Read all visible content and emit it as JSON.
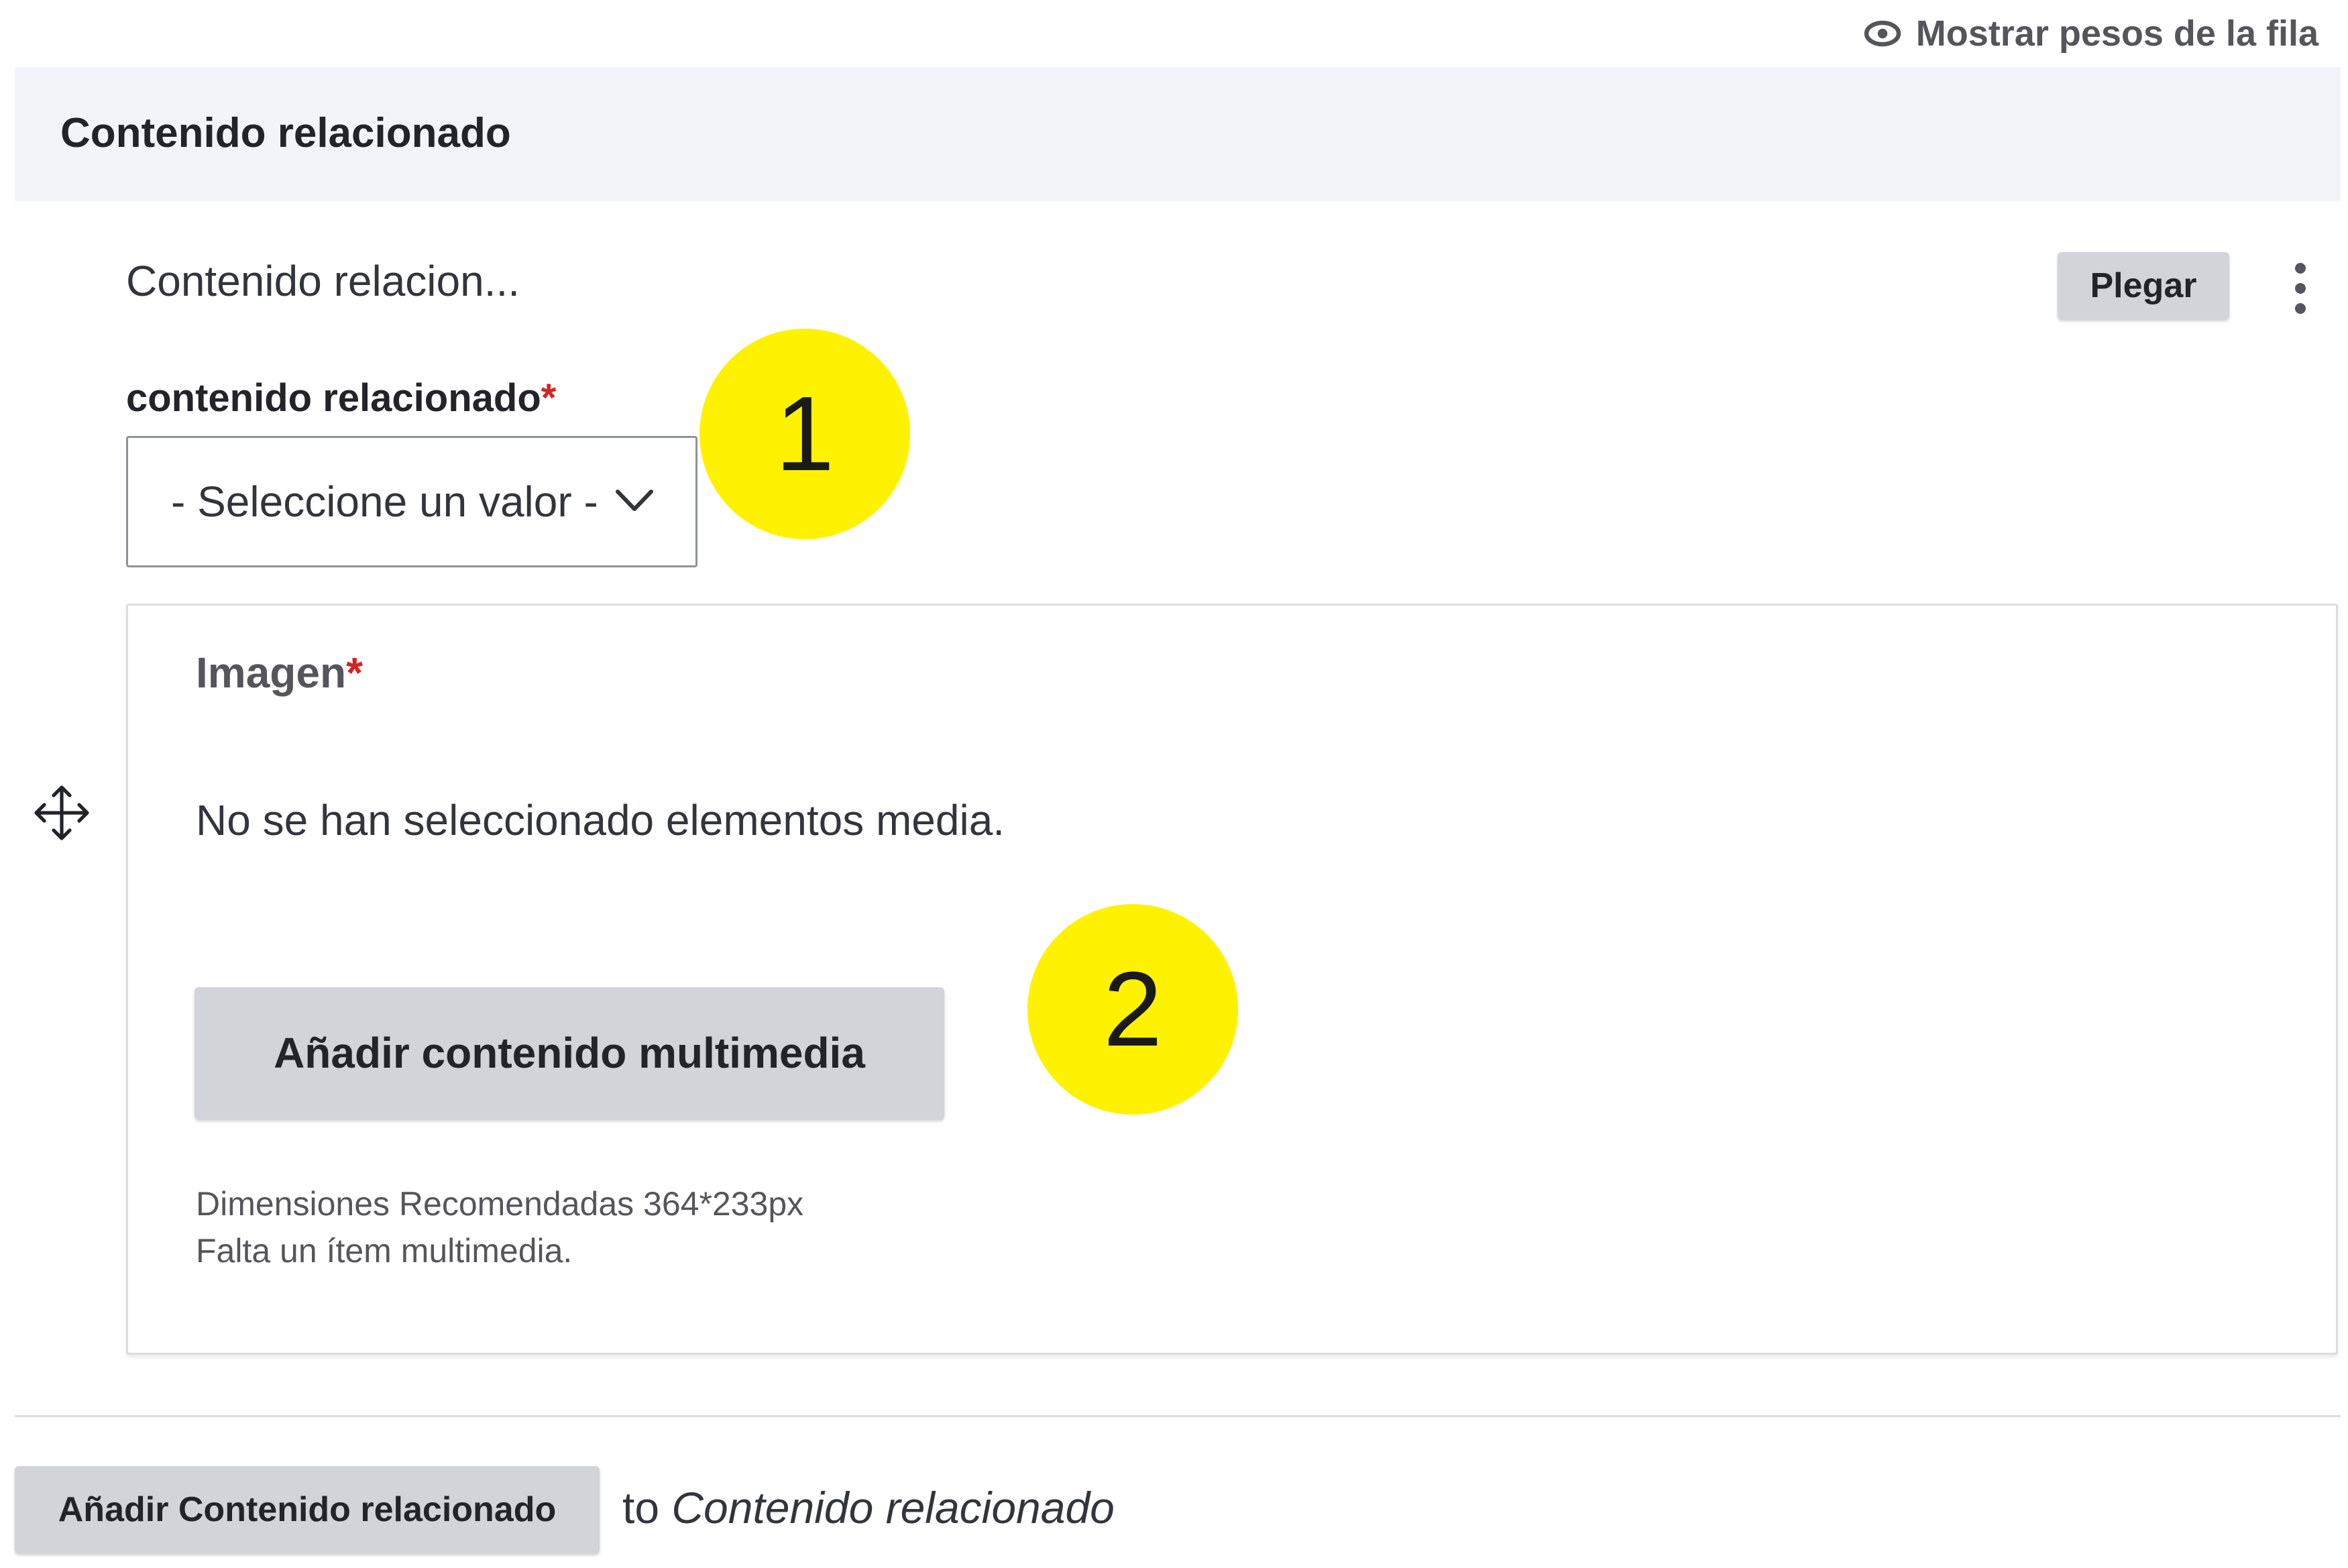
{
  "toggle_weights": {
    "label": "Mostrar pesos de la fila",
    "icon": "eye-icon"
  },
  "header": {
    "title": "Contenido relacionado"
  },
  "paragraph": {
    "summary": "Contenido relacion...",
    "collapse_label": "Plegar",
    "menu_icon": "vertical-dots-icon",
    "drag_icon": "move-handle-icon"
  },
  "related_field": {
    "label": "contenido relacionado",
    "required_mark": "*",
    "select_value": "- Seleccione un valor -"
  },
  "image_field": {
    "label": "Imagen",
    "required_mark": "*",
    "empty_text": "No se han seleccionado elementos media.",
    "add_button": "Añadir contenido multimedia",
    "description_dimensions": "Dimensiones Recomendadas 364*233px",
    "description_missing": "Falta un ítem multimedia."
  },
  "callouts": [
    "1",
    "2"
  ],
  "add_more": {
    "button": "Añadir Contenido relacionado",
    "suffix_prefix": "to",
    "suffix_target": "Contenido relacionado"
  },
  "colors": {
    "header_bg": "#f3f4f9",
    "button_bg": "#d3d4d9",
    "required": "#d72222",
    "callout": "#fff200"
  }
}
